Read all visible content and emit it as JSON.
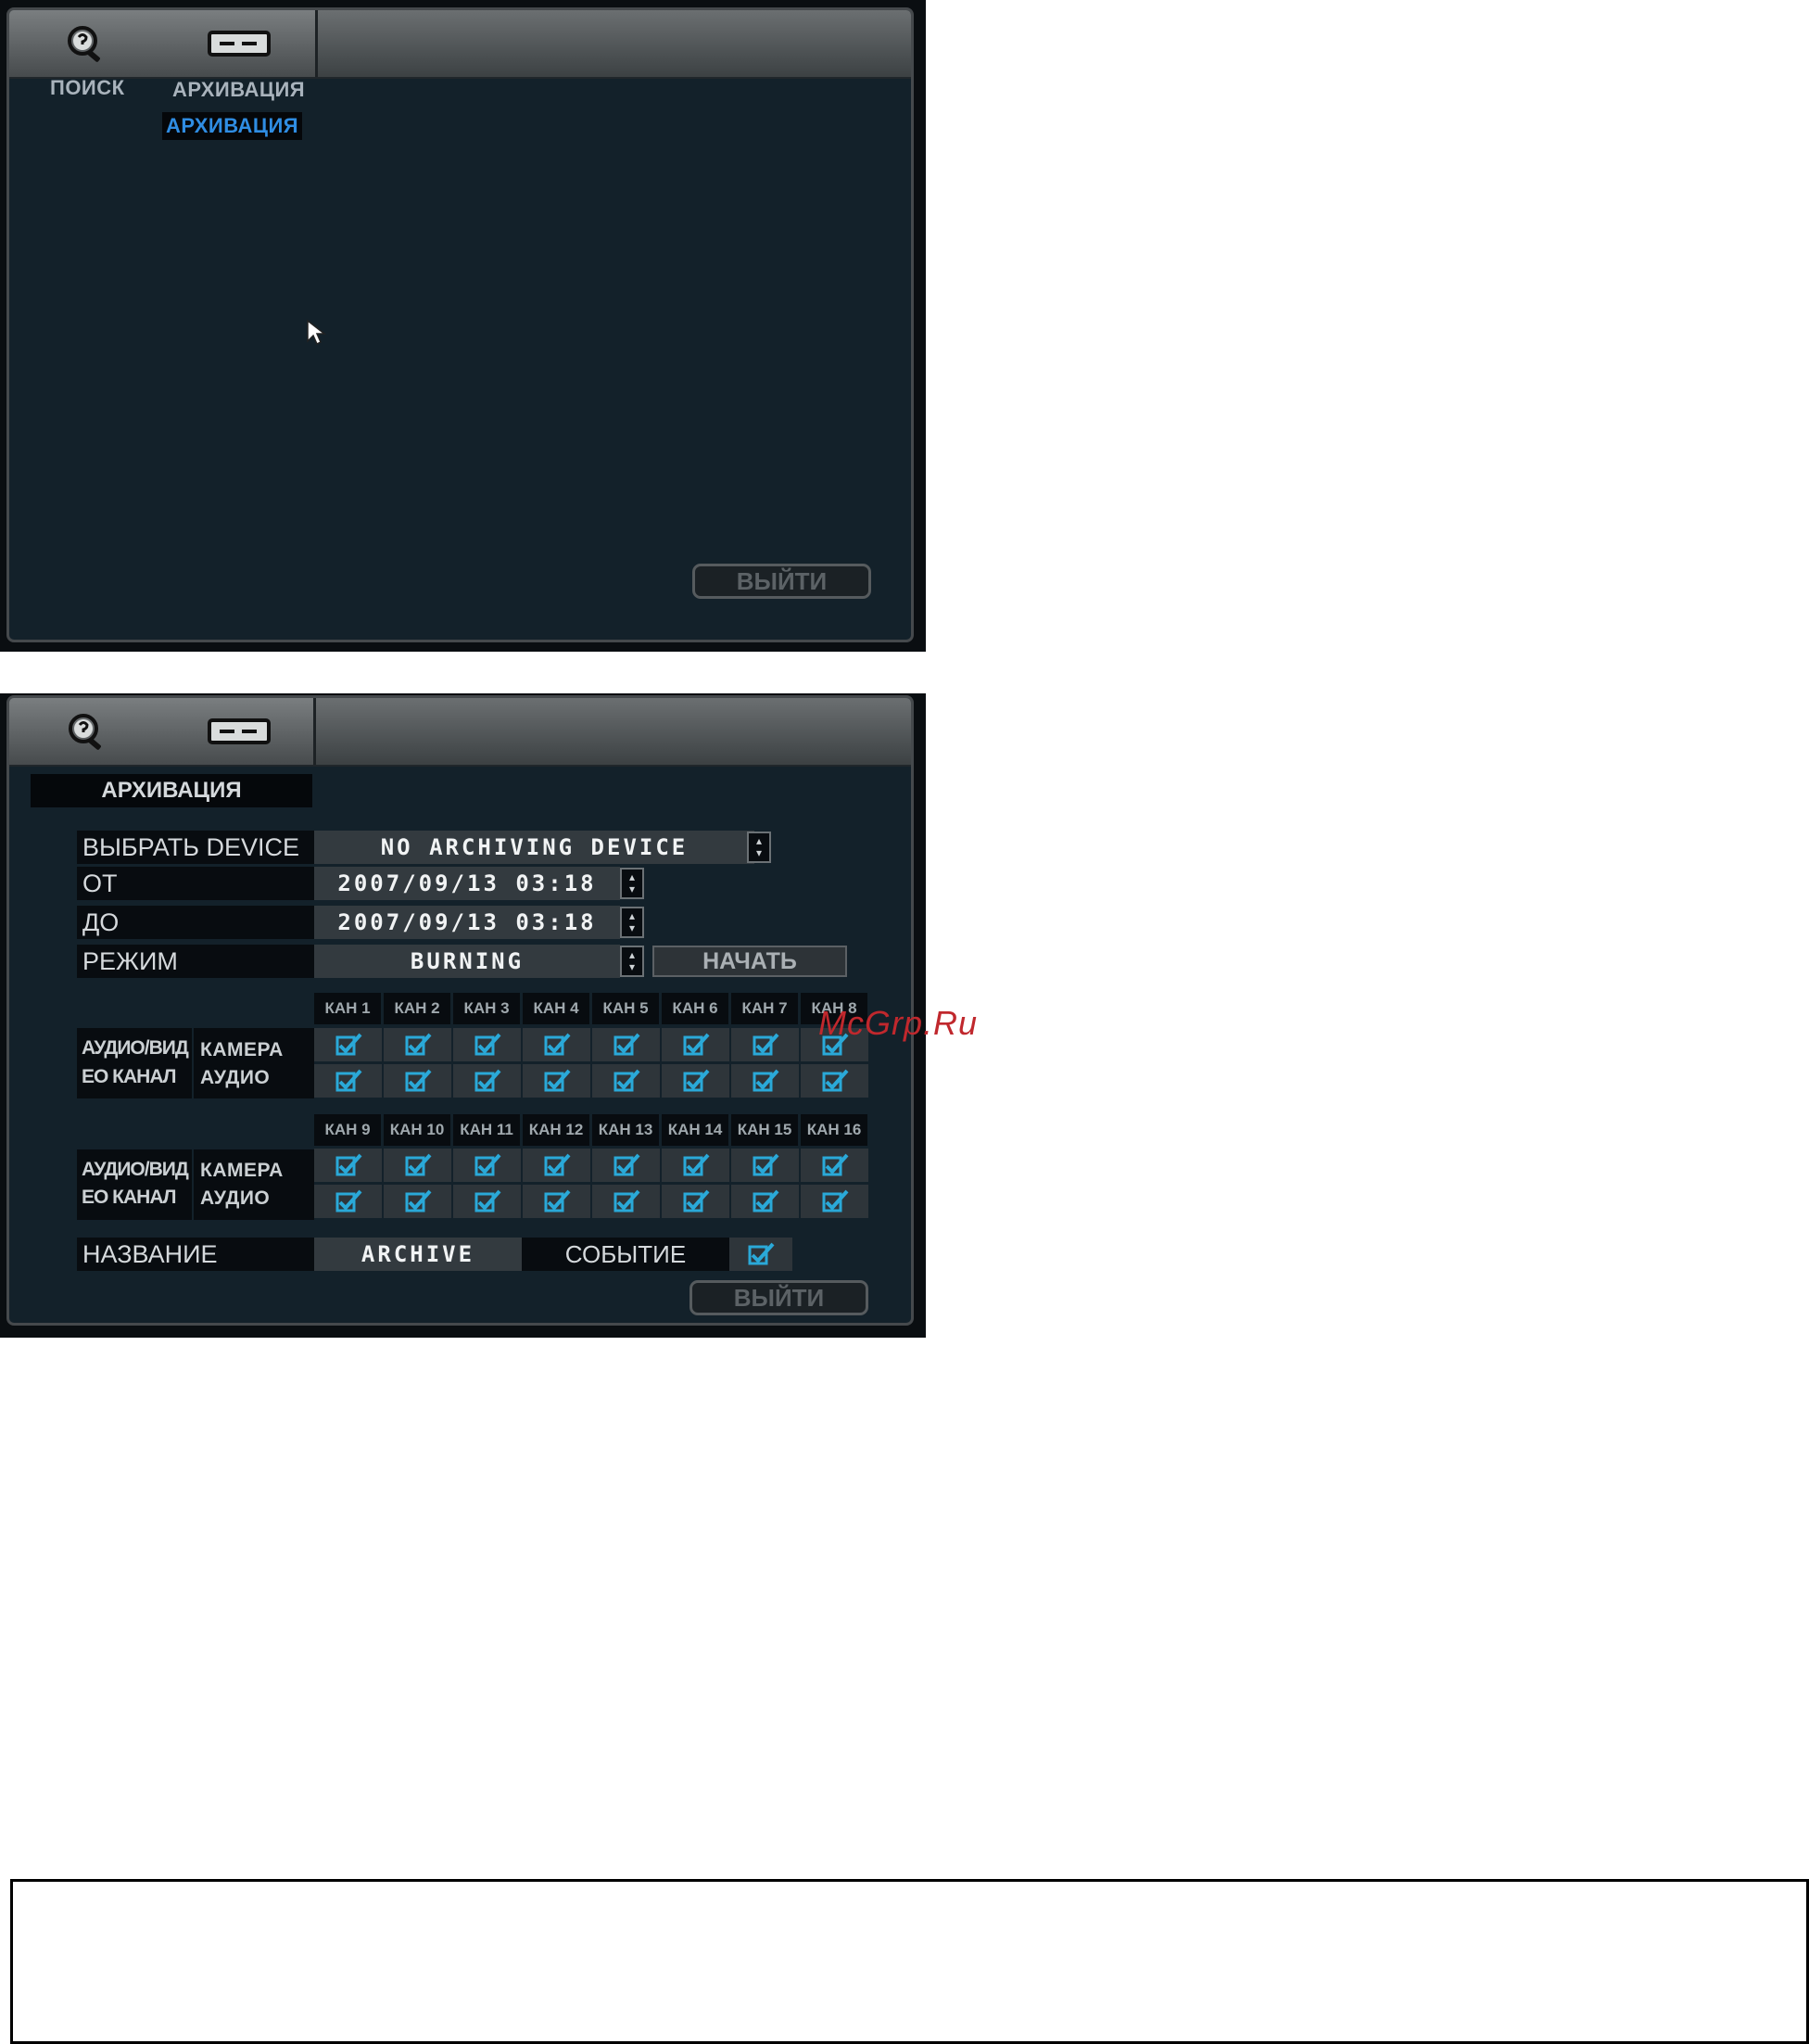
{
  "screen1": {
    "tabs": [
      {
        "icon": "search-icon",
        "label": "ПОИСК"
      },
      {
        "icon": "archive-device-icon",
        "label": "АРХИВАЦИЯ"
      }
    ],
    "submenu_selected": "АРХИВАЦИЯ",
    "exit_button": "ВЫЙТИ",
    "cursor_icon": "mouse-pointer-icon"
  },
  "screen2": {
    "section_title": "АРХИВАЦИЯ",
    "fields": {
      "device": {
        "label": "ВЫБРАТЬ DEVICE",
        "value": "NO ARCHIVING DEVICE"
      },
      "from": {
        "label": "ОТ",
        "value": "2007/09/13 03:18"
      },
      "to": {
        "label": "ДО",
        "value": "2007/09/13 03:18"
      },
      "mode": {
        "label": "РЕЖИМ",
        "value": "BURNING"
      }
    },
    "start_button": "НАЧАТЬ",
    "group1": {
      "channels": [
        "КАН 1",
        "КАН 2",
        "КАН 3",
        "КАН 4",
        "КАН 5",
        "КАН 6",
        "КАН 7",
        "КАН 8"
      ],
      "left_label_1": "АУДИО/ВИД",
      "left_label_2": "ЕО КАНАЛ",
      "row_camera": "КАМЕРА",
      "row_audio": "АУДИО",
      "camera_checked": [
        true,
        true,
        true,
        true,
        true,
        true,
        true,
        true
      ],
      "audio_checked": [
        true,
        true,
        true,
        true,
        true,
        true,
        true,
        true
      ]
    },
    "group2": {
      "channels": [
        "КАН 9",
        "КАН 10",
        "КАН 11",
        "КАН 12",
        "КАН 13",
        "КАН 14",
        "КАН 15",
        "КАН 16"
      ],
      "left_label_1": "АУДИО/ВИД",
      "left_label_2": "ЕО КАНАЛ",
      "row_camera": "КАМЕРА",
      "row_audio": "АУДИО",
      "camera_checked": [
        true,
        true,
        true,
        true,
        true,
        true,
        true,
        true
      ],
      "audio_checked": [
        true,
        true,
        true,
        true,
        true,
        true,
        true,
        true
      ]
    },
    "name": {
      "label": "НАЗВАНИЕ",
      "value": "ARCHIVE"
    },
    "event": {
      "label": "СОБЫТИЕ",
      "checked": true
    },
    "exit_button": "ВЫЙТИ"
  },
  "watermark": "McGrp.Ru",
  "colors": {
    "accent": "#2f8de3",
    "check": "#2aa9d8",
    "watermark": "#c0282d"
  }
}
